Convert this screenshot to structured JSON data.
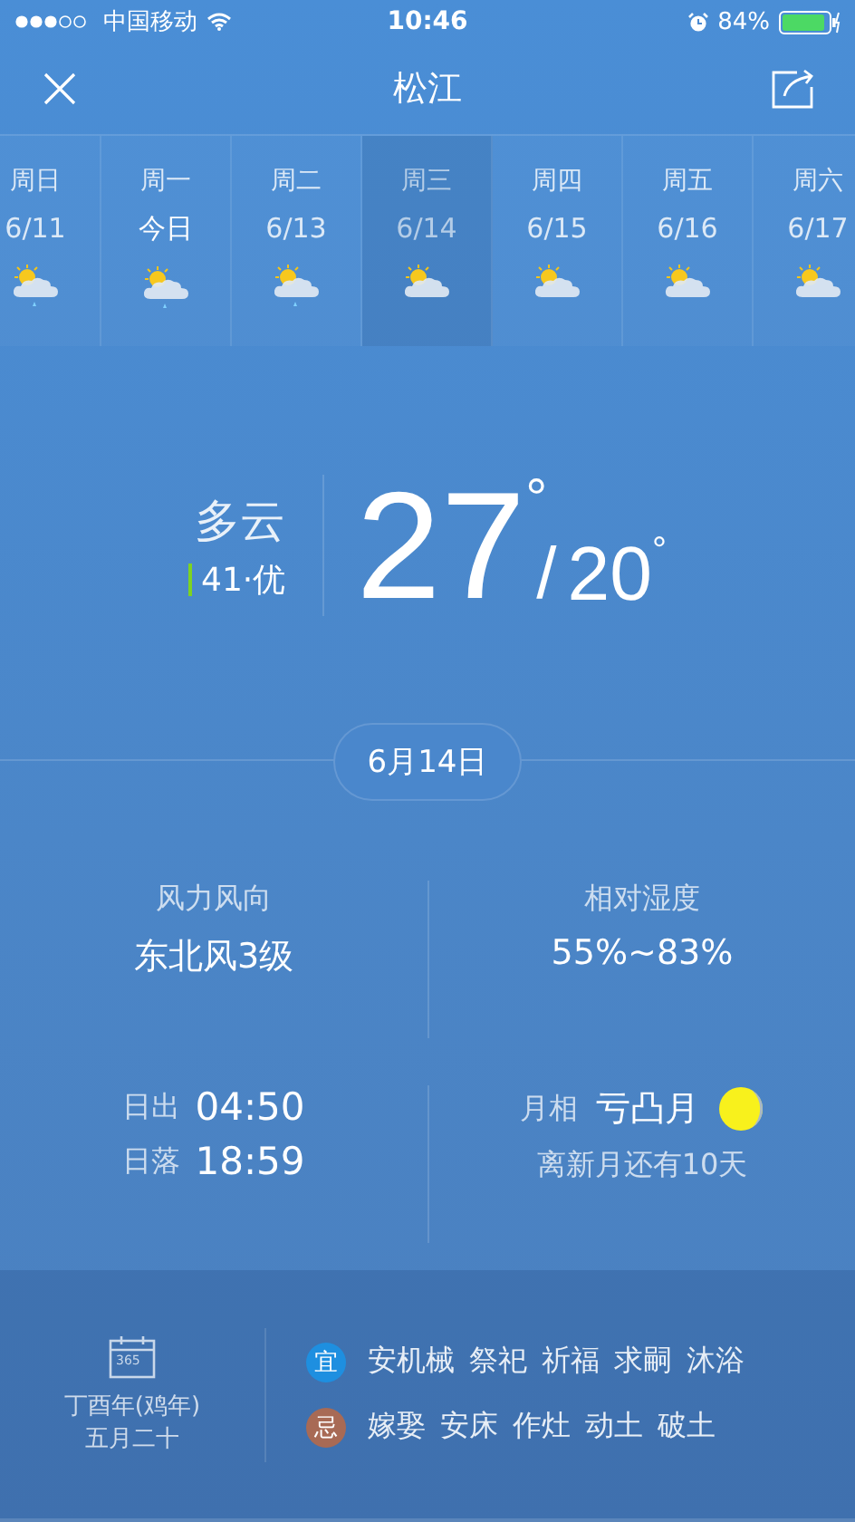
{
  "status_bar": {
    "carrier": "中国移动",
    "time": "10:46",
    "battery": "84%"
  },
  "header": {
    "title": "松江"
  },
  "days": [
    {
      "weekday": "周日",
      "date": "6/11",
      "kind": "rain",
      "selected": false,
      "today": false
    },
    {
      "weekday": "周一",
      "date": "今日",
      "kind": "rain",
      "selected": false,
      "today": true
    },
    {
      "weekday": "周二",
      "date": "6/13",
      "kind": "rain",
      "selected": false,
      "today": false
    },
    {
      "weekday": "周三",
      "date": "6/14",
      "kind": "cloudy",
      "selected": true,
      "today": false
    },
    {
      "weekday": "周四",
      "date": "6/15",
      "kind": "cloudy",
      "selected": false,
      "today": false
    },
    {
      "weekday": "周五",
      "date": "6/16",
      "kind": "cloudy",
      "selected": false,
      "today": false
    },
    {
      "weekday": "周六",
      "date": "6/17",
      "kind": "cloudy",
      "selected": false,
      "today": false
    }
  ],
  "current": {
    "condition": "多云",
    "aqi": {
      "text": "41·优",
      "color": "#7ed321"
    },
    "high": "27",
    "high_unit": "°",
    "separator": "/",
    "low": "20",
    "low_unit": "°"
  },
  "date_pill": "6月14日",
  "details": {
    "wind_label": "风力风向",
    "wind": "东北风3级",
    "humidity_label": "相对湿度",
    "humidity": "55%~83%",
    "sunrise_label": "日出",
    "sunrise": "04:50",
    "sunset_label": "日落",
    "sunset": "18:59",
    "moon_label": "月相",
    "moon": "亏凸月",
    "moon_note": "离新月还有10天"
  },
  "almanac": {
    "calendar_number": "365",
    "lunar_year": "丁酉年(鸡年)",
    "lunar_date": "五月二十",
    "rows": [
      {
        "badge": "宜",
        "color": "#1e8fe0",
        "items": [
          "安机械",
          "祭祀",
          "祈福",
          "求嗣",
          "沐浴"
        ]
      },
      {
        "badge": "忌",
        "color": "#a86a55",
        "items": [
          "嫁娶",
          "安床",
          "作灶",
          "动土",
          "破土"
        ]
      }
    ]
  }
}
